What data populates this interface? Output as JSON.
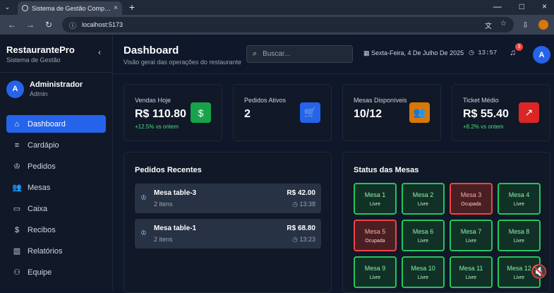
{
  "browser": {
    "tab_title": "Sistema de Gestão Completo p",
    "url": "localhost:5173"
  },
  "sidebar": {
    "brand_name": "RestaurantePro",
    "brand_subtitle": "Sistema de Gestão",
    "user_initial": "A",
    "user_name": "Administrador",
    "user_role": "Admin",
    "items": [
      {
        "label": "Dashboard",
        "icon": "home-icon"
      },
      {
        "label": "Cardápio",
        "icon": "list-icon"
      },
      {
        "label": "Pedidos",
        "icon": "chef-hat-icon"
      },
      {
        "label": "Mesas",
        "icon": "users-icon"
      },
      {
        "label": "Caixa",
        "icon": "card-icon"
      },
      {
        "label": "Recibos",
        "icon": "receipt-icon"
      },
      {
        "label": "Relatórios",
        "icon": "bar-chart-icon"
      },
      {
        "label": "Equipe",
        "icon": "team-icon"
      }
    ]
  },
  "header": {
    "title": "Dashboard",
    "subtitle": "Visão geral das operações do restaurante",
    "search_placeholder": "Buscar...",
    "date": "Sexta-Feira, 4 De Julho De 2025",
    "time": "13:57",
    "notification_count": "3",
    "avatar_initial": "A"
  },
  "stats": [
    {
      "label": "Vendas Hoje",
      "value": "R$ 110.80",
      "change": "+12.5% vs ontem",
      "icon": "$",
      "color": "#16a34a"
    },
    {
      "label": "Pedidos Ativos",
      "value": "2",
      "change": "",
      "icon": "🛒",
      "color": "#2563eb"
    },
    {
      "label": "Mesas Disponíveis",
      "value": "10/12",
      "change": "",
      "icon": "👥",
      "color": "#d97706"
    },
    {
      "label": "Ticket Médio",
      "value": "R$ 55.40",
      "change": "+8.2% vs ontem",
      "icon": "↗",
      "color": "#dc2626"
    }
  ],
  "recent_orders": {
    "title": "Pedidos Recentes",
    "orders": [
      {
        "name": "Mesa table-3",
        "items": "2 itens",
        "price": "R$ 42.00",
        "time": "13:38"
      },
      {
        "name": "Mesa table-1",
        "items": "2 itens",
        "price": "R$ 68.80",
        "time": "13:23"
      }
    ]
  },
  "tables_status": {
    "title": "Status das Mesas",
    "tables": [
      {
        "name": "Mesa 1",
        "status": "Livre"
      },
      {
        "name": "Mesa 2",
        "status": "Livre"
      },
      {
        "name": "Mesa 3",
        "status": "Ocupada"
      },
      {
        "name": "Mesa 4",
        "status": "Livre"
      },
      {
        "name": "Mesa 5",
        "status": "Ocupada"
      },
      {
        "name": "Mesa 6",
        "status": "Livre"
      },
      {
        "name": "Mesa 7",
        "status": "Livre"
      },
      {
        "name": "Mesa 8",
        "status": "Livre"
      },
      {
        "name": "Mesa 9",
        "status": "Livre"
      },
      {
        "name": "Mesa 10",
        "status": "Livre"
      },
      {
        "name": "Mesa 11",
        "status": "Livre"
      },
      {
        "name": "Mesa 12",
        "status": "Livre"
      }
    ]
  }
}
